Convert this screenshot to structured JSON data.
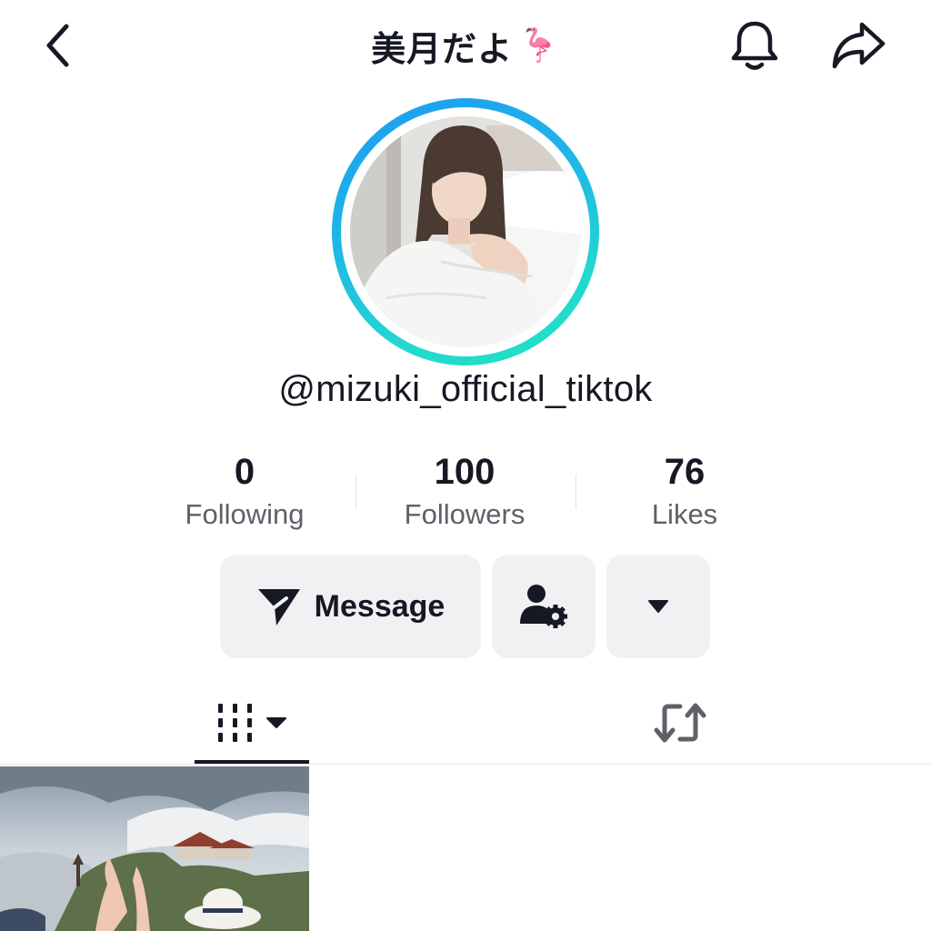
{
  "header": {
    "title": "美月だよ",
    "title_emoji": "🦩",
    "back_icon": "chevron-left-icon",
    "bell_icon": "bell-icon",
    "share_icon": "share-arrow-icon"
  },
  "profile": {
    "username": "@mizuki_official_tiktok",
    "avatar_ring_colors": [
      "#1d9bf0",
      "#20e3c2"
    ]
  },
  "stats": [
    {
      "value": "0",
      "label": "Following"
    },
    {
      "value": "100",
      "label": "Followers"
    },
    {
      "value": "76",
      "label": "Likes"
    }
  ],
  "actions": {
    "message_label": "Message",
    "message_icon": "send-icon",
    "friend_settings_icon": "user-gear-icon",
    "more_icon": "caret-down-icon"
  },
  "tabs": {
    "videos_icon": "grid-columns-icon",
    "videos_dropdown_icon": "caret-down-icon",
    "reposts_icon": "repost-icon"
  },
  "colors": {
    "text_primary": "#161823",
    "text_secondary": "#5f6068",
    "button_bg": "#f1f1f3"
  }
}
